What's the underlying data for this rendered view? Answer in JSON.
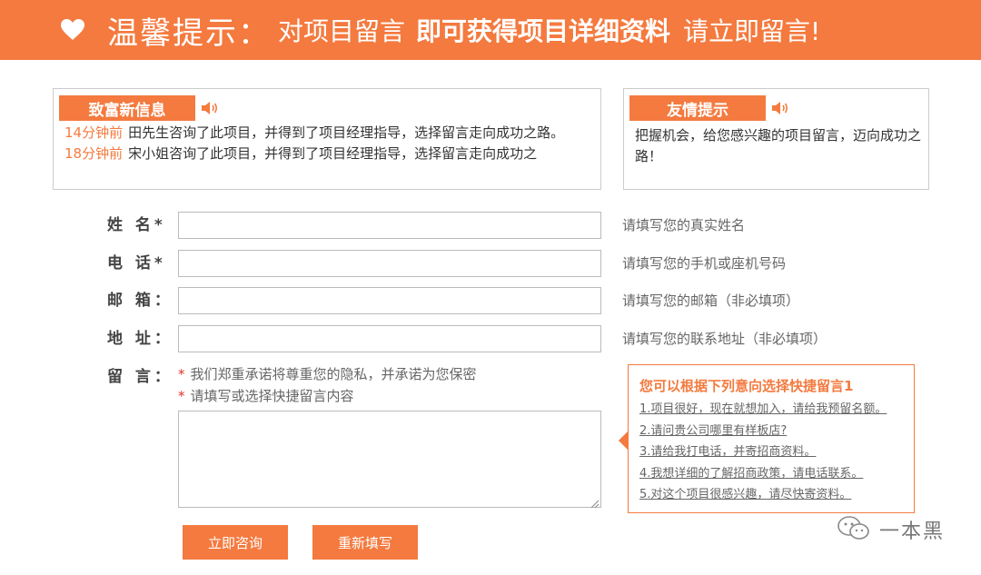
{
  "banner": {
    "icon": "heart-icon",
    "title_prefix": "温馨提示：",
    "title_part1": "对项目留言",
    "title_part2": "即可获得项目详细资料",
    "title_part3": "请立即留言!"
  },
  "news_box": {
    "tag": "致富新信息",
    "icon": "speaker-icon",
    "items": [
      {
        "time": "14分钟前",
        "text": "田先生咨询了此项目，并得到了项目经理指导，选择留言走向成功之路。"
      },
      {
        "time": "18分钟前",
        "text": "宋小姐咨询了此项目，并得到了项目经理指导，选择留言走向成功之"
      }
    ]
  },
  "tip_box": {
    "tag": "友情提示",
    "icon": "speaker-icon",
    "text": "把握机会，给您感兴趣的项目留言，迈向成功之路！"
  },
  "form": {
    "fields": [
      {
        "label": "姓 名*",
        "value": "",
        "hint": "请填写您的真实姓名"
      },
      {
        "label": "电 话*",
        "value": "",
        "hint": "请填写您的手机或座机号码"
      },
      {
        "label": "邮 箱：",
        "value": "",
        "hint": "请填写您的邮箱（非必填项）"
      },
      {
        "label": "地 址：",
        "value": "",
        "hint": "请填写您的联系地址（非必填项）"
      }
    ],
    "message_label": "留 言：",
    "notes": [
      {
        "star": "*",
        "text": "我们郑重承诺将尊重您的隐私，并承诺为您保密"
      },
      {
        "star": "*",
        "text": "请填写或选择快捷留言内容"
      }
    ],
    "message_value": "",
    "submit_label": "立即咨询",
    "reset_label": "重新填写"
  },
  "quick_messages": {
    "title": "您可以根据下列意向选择快捷留言1",
    "items": [
      "1.项目很好，现在就想加入，请给我预留名额。",
      "2.请问贵公司哪里有样板店?",
      "3.请给我打电话，并寄招商资料。",
      "4.我想详细的了解招商政策，请电话联系。",
      "5.对这个项目很感兴趣，请尽快寄资料。"
    ]
  },
  "watermark": {
    "text": "一本黑",
    "icon": "wechat-icon"
  },
  "colors": {
    "accent": "#f47a3f",
    "star": "#e0332b",
    "border": "#cccccc"
  }
}
